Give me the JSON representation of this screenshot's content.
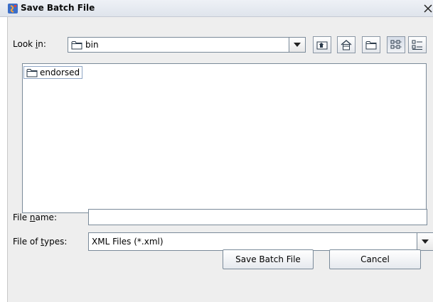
{
  "window": {
    "title": "Save Batch File",
    "close_glyph": "×",
    "app_icon": "java-app-icon"
  },
  "look_in": {
    "label_prefix": "Look ",
    "label_mnemonic": "i",
    "label_suffix": "n:",
    "value": "bin",
    "icon": "folder-icon"
  },
  "toolbar": {
    "up_one_level": "up-folder-icon",
    "home": "home-icon",
    "new_folder": "new-folder-icon",
    "list_view": "list-view-icon",
    "details_view": "details-view-icon",
    "active_view": "list_view"
  },
  "files": [
    {
      "name": "endorsed",
      "icon": "folder-icon",
      "selected": true
    }
  ],
  "file_name": {
    "label_prefix": "File ",
    "label_mnemonic": "n",
    "label_suffix": "ame:",
    "value": ""
  },
  "file_type": {
    "label_prefix": "File of ",
    "label_mnemonic": "t",
    "label_suffix": "ypes:",
    "value": "XML Files (*.xml)"
  },
  "buttons": {
    "save": "Save Batch File",
    "cancel": "Cancel"
  },
  "colors": {
    "dialog_bg": "#eeeeee",
    "border": "#7a8a99"
  }
}
